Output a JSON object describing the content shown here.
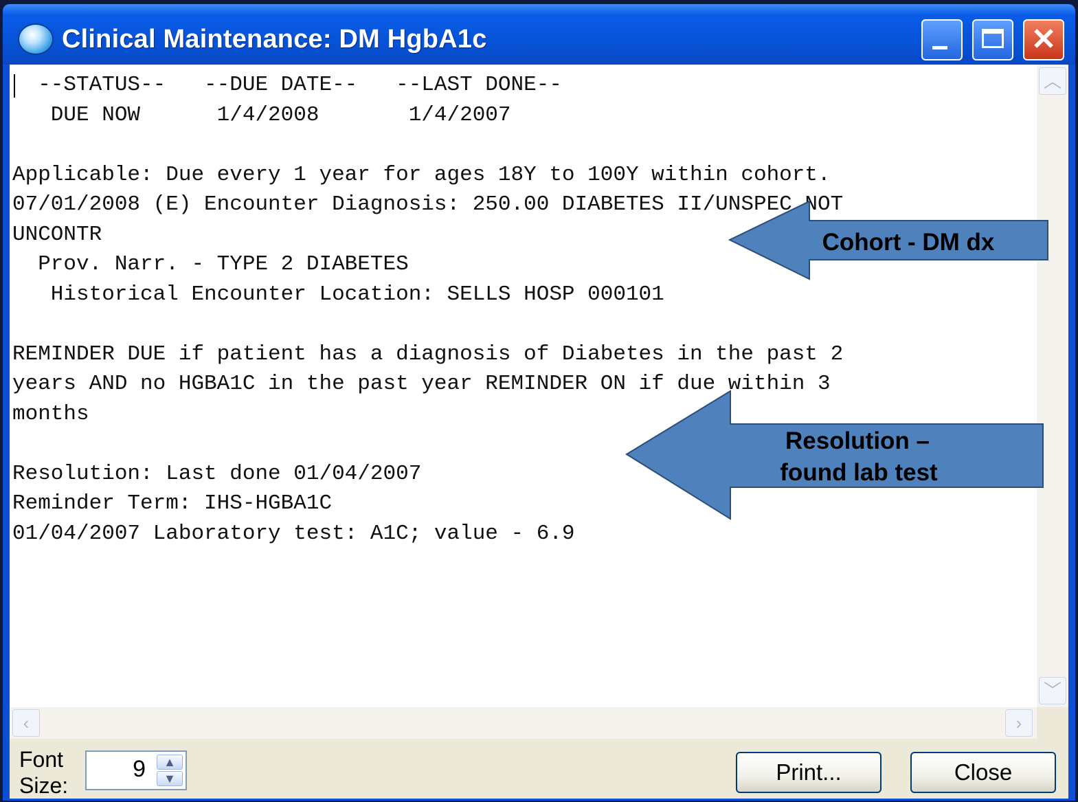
{
  "window": {
    "title": "Clinical Maintenance: DM HgbA1c",
    "close_glyph": "✕"
  },
  "report_text": "  --STATUS--   --DUE DATE--   --LAST DONE--\n   DUE NOW      1/4/2008       1/4/2007\n\nApplicable: Due every 1 year for ages 18Y to 100Y within cohort.\n07/01/2008 (E) Encounter Diagnosis: 250.00 DIABETES II/UNSPEC NOT\nUNCONTR\n  Prov. Narr. - TYPE 2 DIABETES\n   Historical Encounter Location: SELLS HOSP 000101\n\nREMINDER DUE if patient has a diagnosis of Diabetes in the past 2\nyears AND no HGBA1C in the past year REMINDER ON if due within 3\nmonths\n\nResolution: Last done 01/04/2007\nReminder Term: IHS-HGBA1C\n01/04/2007 Laboratory test: A1C; value - 6.9",
  "scrollbars": {
    "up": "︿",
    "down": "﹀",
    "left": "‹",
    "right": "›"
  },
  "footer": {
    "font_label_line1": "Font",
    "font_label_line2": "Size:",
    "font_size_value": "9",
    "spin_up": "▲",
    "spin_down": "▼",
    "print_label": "Print...",
    "close_label": "Close"
  },
  "annotations": {
    "cohort": "Cohort - DM dx",
    "resolution_line1": "Resolution –",
    "resolution_line2": "found lab test",
    "arrow_color": "#4f81bd",
    "arrow_stroke": "#2c4d75"
  }
}
